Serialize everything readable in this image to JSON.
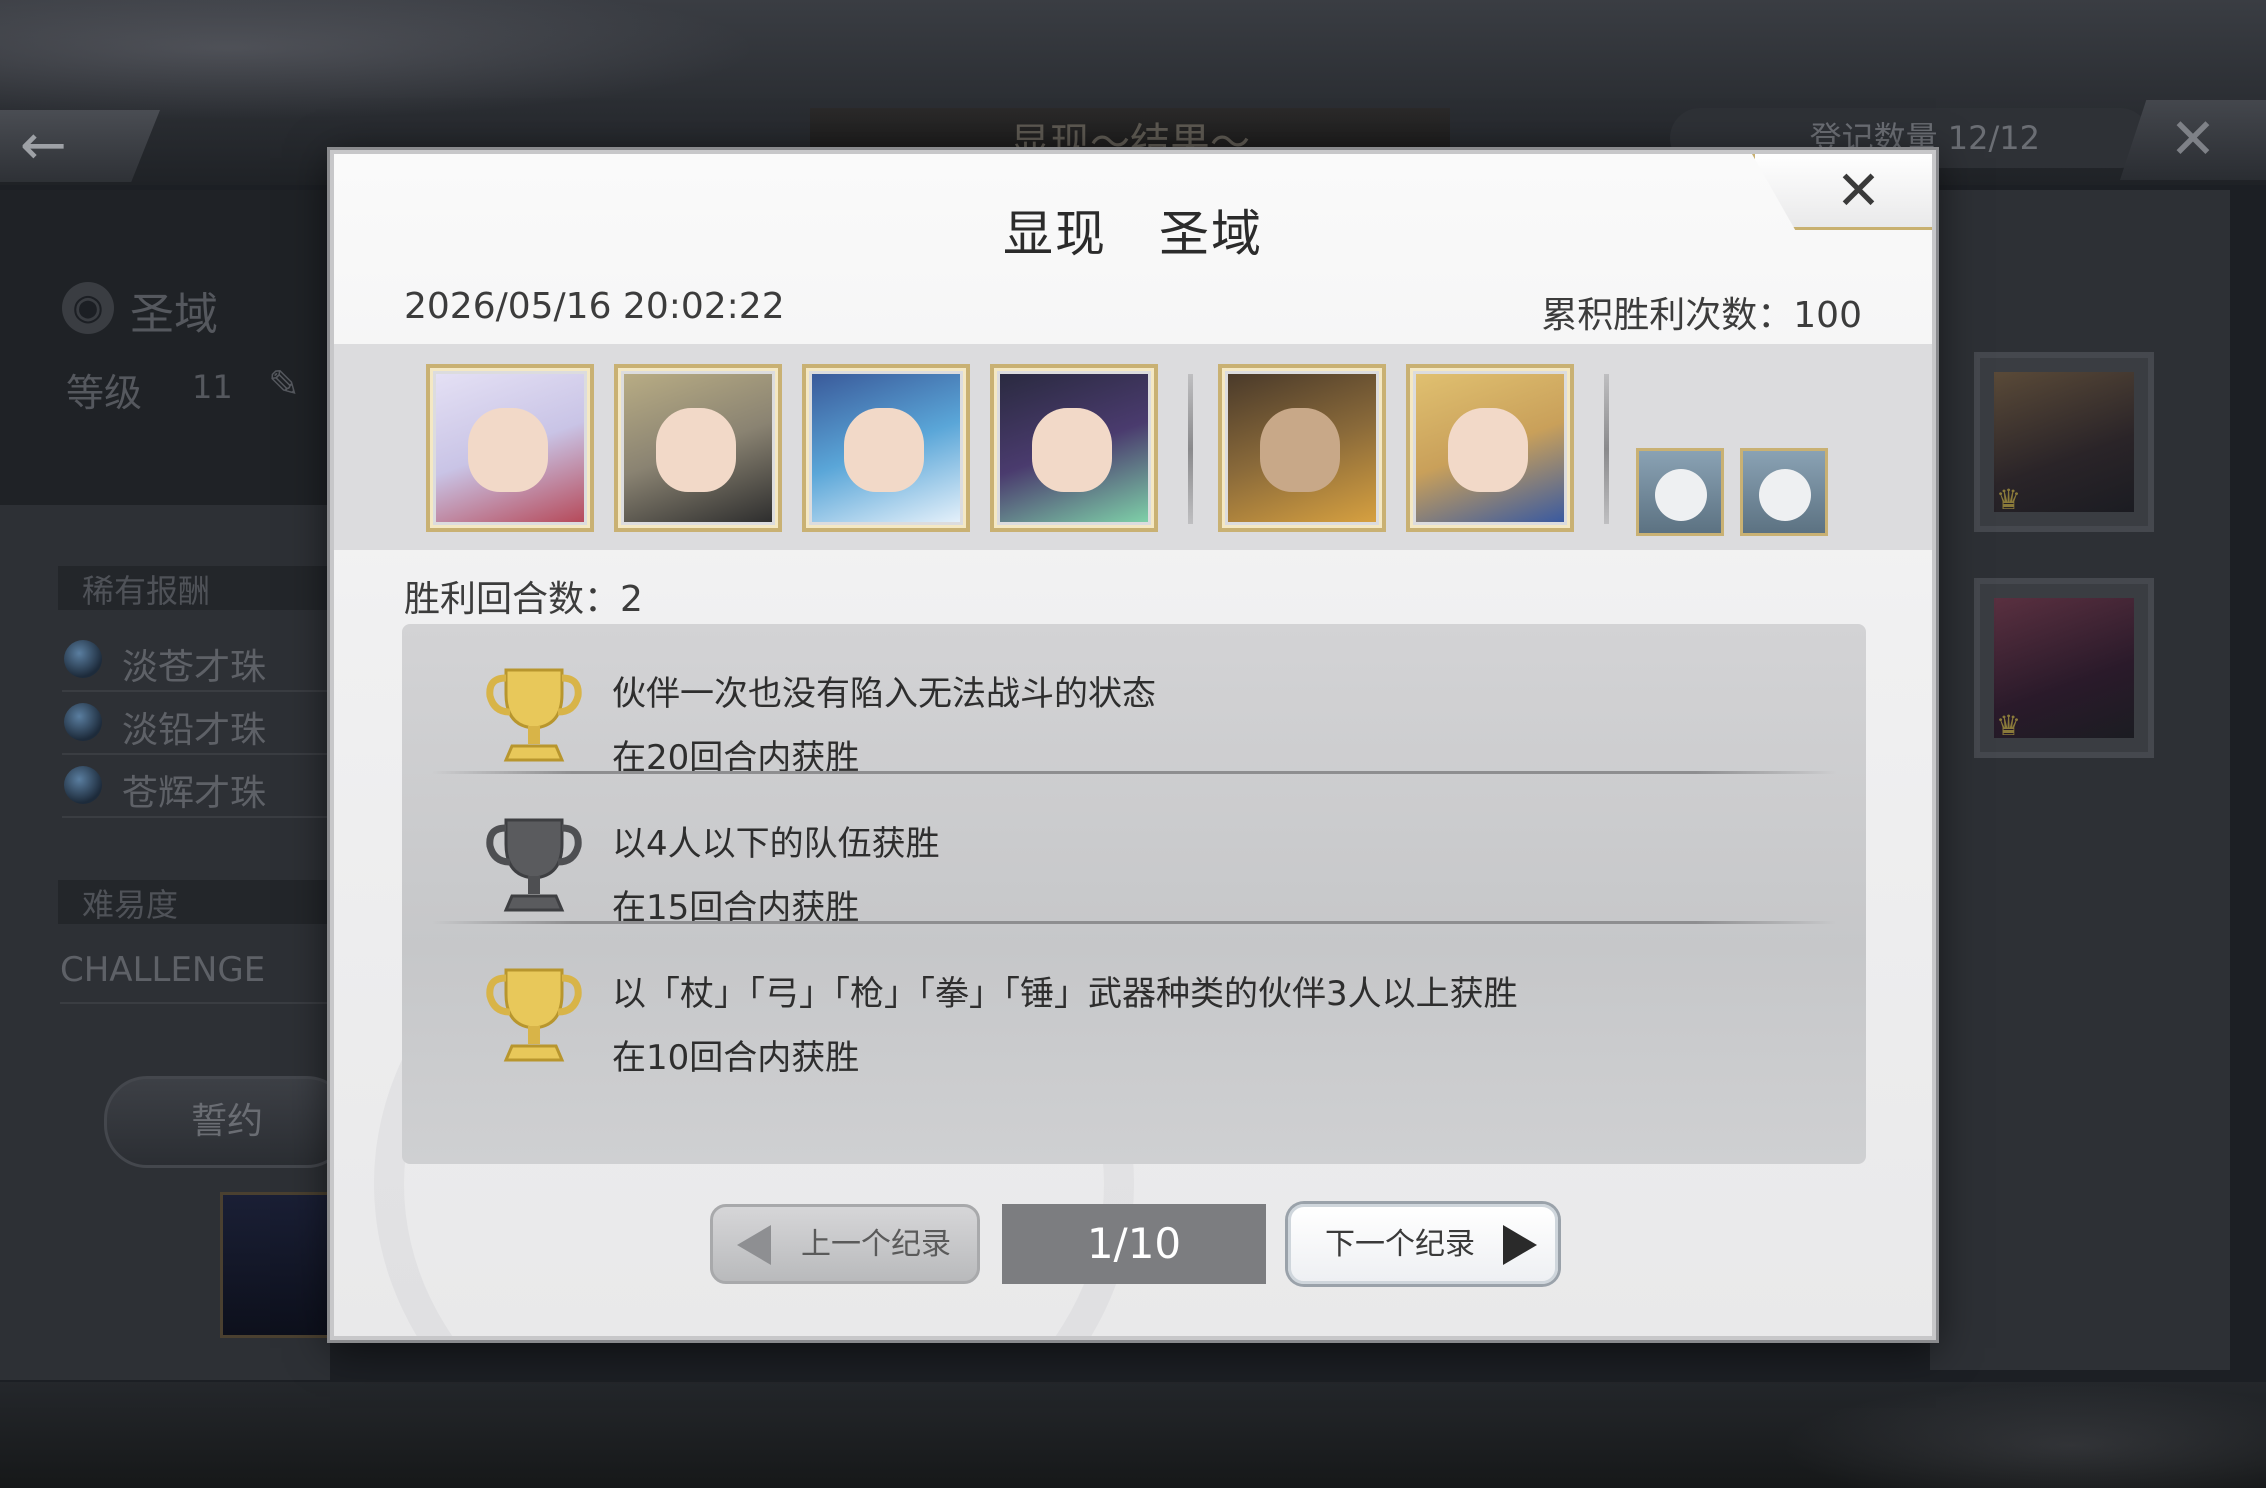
{
  "background": {
    "header_title": "显现～结果～",
    "register_count": "登记数量 12/12",
    "stage_name": "圣域",
    "level_label": "等级",
    "level_value": "11",
    "rare_reward_label": "稀有报酬",
    "rewards": [
      "淡苍才珠",
      "淡铅才珠",
      "苍辉才珠"
    ],
    "difficulty_label": "难易度",
    "difficulty_value": "CHALLENGE",
    "oath_label": "誓约"
  },
  "modal": {
    "title": "显现　圣域",
    "datetime": "2026/05/16 20:02:22",
    "wins_label": "累积胜利次数：100",
    "turns_label": "胜利回合数：2",
    "party": {
      "characters": [
        {
          "name": "char-1",
          "bg": "#c9c4e6",
          "accent": "#d23a3a"
        },
        {
          "name": "char-2",
          "bg": "#8a8372",
          "accent": "#2a2a2a"
        },
        {
          "name": "char-3",
          "bg": "#5aa6d8",
          "accent": "#e04a6a"
        },
        {
          "name": "char-4",
          "bg": "#4a3b6e",
          "accent": "#7ed0a8"
        },
        {
          "name": "char-5",
          "bg": "#8a6a3a",
          "accent": "#c23030"
        },
        {
          "name": "char-6",
          "bg": "#c9a05a",
          "accent": "#3a5aa0"
        }
      ],
      "pets": [
        "pet-1",
        "pet-2"
      ]
    },
    "missions": [
      {
        "line1": "伙伴一次也没有陷入无法战斗的状态",
        "line2": "在20回合内获胜",
        "trophy": "gold"
      },
      {
        "line1": "以4人以下的队伍获胜",
        "line2": "在15回合内获胜",
        "trophy": "dark"
      },
      {
        "line1": "以「杖」「弓」「枪」「拳」「锤」武器种类的伙伴3人以上获胜",
        "line2": "在10回合内获胜",
        "trophy": "gold"
      }
    ],
    "nav": {
      "prev_label": "上一个纪录",
      "page": "1/10",
      "next_label": "下一个纪录"
    },
    "colors": {
      "gold_trophy": "#e8c85a",
      "dark_trophy": "#5a5b5e",
      "frame_gold": "#c9b173"
    }
  }
}
